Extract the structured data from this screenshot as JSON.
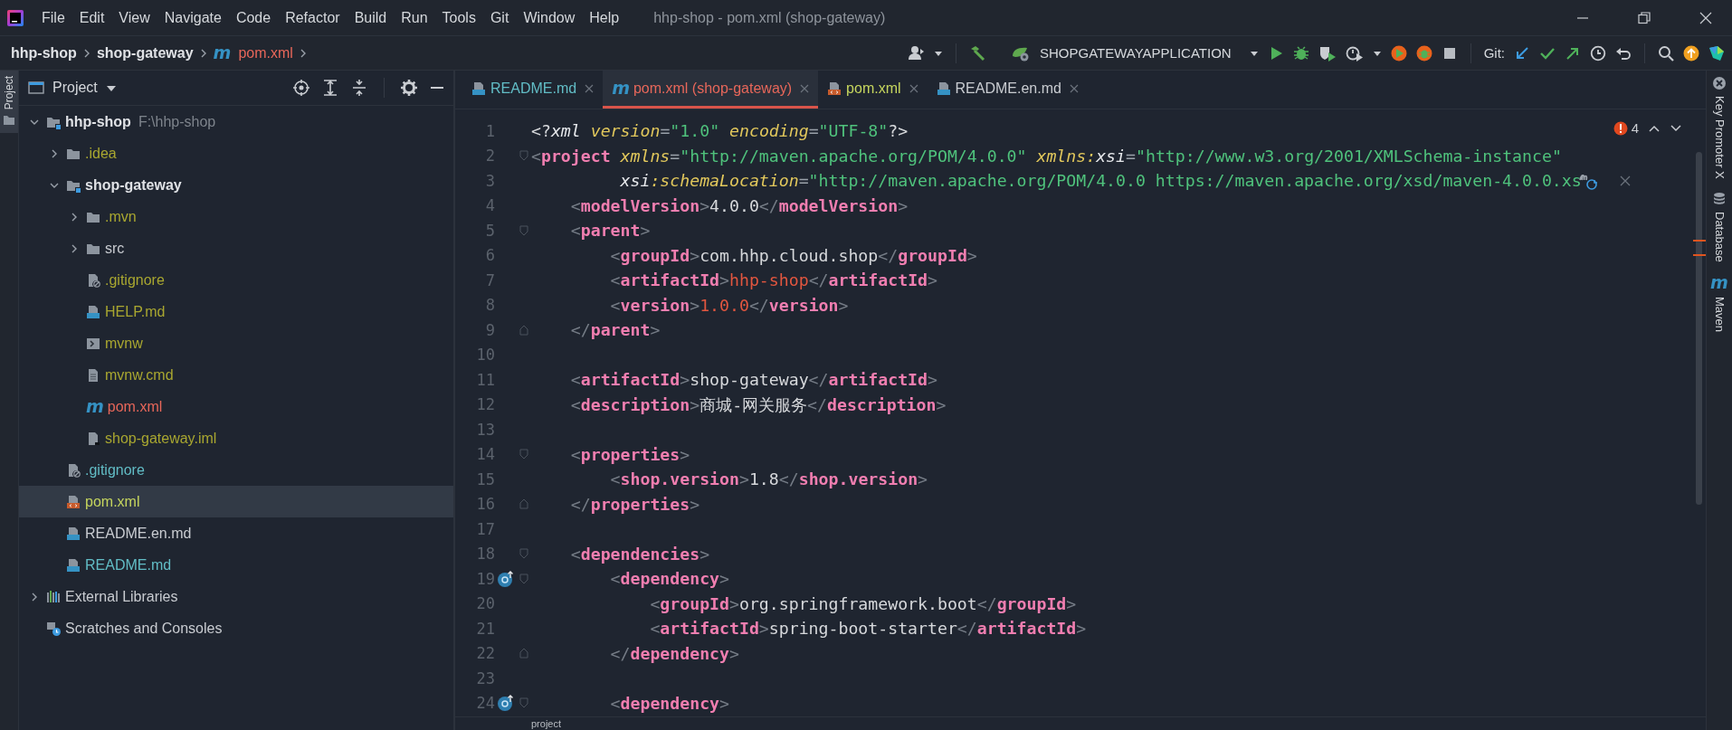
{
  "window": {
    "title": "hhp-shop - pom.xml (shop-gateway)"
  },
  "menu": [
    "File",
    "Edit",
    "View",
    "Navigate",
    "Code",
    "Refactor",
    "Build",
    "Run",
    "Tools",
    "Git",
    "Window",
    "Help"
  ],
  "breadcrumbs": [
    {
      "label": "hhp-shop",
      "kind": "module",
      "color": "#dfe1e5"
    },
    {
      "label": "shop-gateway",
      "kind": "module",
      "color": "#dfe1e5"
    },
    {
      "label": "pom.xml",
      "kind": "maven",
      "icon_text": "m",
      "color": "#e8675a"
    }
  ],
  "toolbar": {
    "run_config": "SHOPGATEWAYAPPLICATION",
    "git_label": "Git:"
  },
  "left_stripe": [
    {
      "label": "Project",
      "selected": true
    }
  ],
  "project_panel": {
    "title": "Project",
    "tree": [
      {
        "label": "hhp-shop",
        "hint": "F:\\hhp-shop",
        "kind": "module",
        "color": "#dfe1e5",
        "selected": false,
        "expanded": true,
        "children": [
          {
            "label": ".idea",
            "kind": "folder",
            "color": "#a9a730",
            "selected": false,
            "expanded": false
          },
          {
            "label": "shop-gateway",
            "kind": "module",
            "color": "#dfe1e5",
            "selected": false,
            "expanded": true,
            "children": [
              {
                "label": ".mvn",
                "kind": "folder",
                "color": "#a9a730",
                "selected": false,
                "expanded": false
              },
              {
                "label": "src",
                "kind": "folder",
                "color": "#c9ccd1",
                "selected": false,
                "expanded": false
              },
              {
                "label": ".gitignore",
                "kind": "ignored",
                "color": "#a9a730",
                "selected": false
              },
              {
                "label": "HELP.md",
                "kind": "markdown",
                "color": "#a9a730",
                "selected": false
              },
              {
                "label": "mvnw",
                "kind": "shell",
                "color": "#a9a730",
                "selected": false
              },
              {
                "label": "mvnw.cmd",
                "kind": "text",
                "color": "#a9a730",
                "selected": false
              },
              {
                "label": "pom.xml",
                "kind": "maven",
                "icon_text": "m",
                "color": "#e8675a",
                "selected": false
              },
              {
                "label": "shop-gateway.iml",
                "kind": "iml",
                "color": "#a9a730",
                "selected": false
              }
            ]
          },
          {
            "label": ".gitignore",
            "kind": "ignored",
            "color": "#62bdc6",
            "selected": false
          },
          {
            "label": "pom.xml",
            "kind": "xml",
            "color": "#c6d65e",
            "selected": true
          },
          {
            "label": "README.en.md",
            "kind": "markdown",
            "color": "#c9ccd1",
            "selected": false
          },
          {
            "label": "README.md",
            "kind": "markdown",
            "color": "#62bdc6",
            "selected": false
          }
        ]
      },
      {
        "label": "External Libraries",
        "kind": "libraries",
        "color": "#c9ccd1",
        "selected": false,
        "expanded": false
      },
      {
        "label": "Scratches and Consoles",
        "kind": "scratches",
        "color": "#c9ccd1",
        "selected": false
      }
    ]
  },
  "tabs": [
    {
      "label": "README.md",
      "kind": "markdown",
      "color": "#62bdc6",
      "selected": false
    },
    {
      "label": "pom.xml (shop-gateway)",
      "kind": "maven",
      "icon_text": "m",
      "color": "#e8675a",
      "selected": true
    },
    {
      "label": "pom.xml",
      "kind": "xml",
      "color": "#c6d65e",
      "selected": false
    },
    {
      "label": "README.en.md",
      "kind": "markdown",
      "color": "#c9ccd1",
      "selected": false
    }
  ],
  "problems": {
    "count": "4"
  },
  "code_lines": [
    {
      "number": "1",
      "kind": "plain",
      "tokens": [
        {
          "kind": "text",
          "text": "<?"
        },
        {
          "kind": "ns",
          "text": "xml"
        },
        {
          "kind": "attr",
          "text": " version"
        },
        {
          "kind": "punct",
          "text": "="
        },
        {
          "kind": "string",
          "text": "\"1.0\""
        },
        {
          "kind": "attr",
          "text": " encoding"
        },
        {
          "kind": "punct",
          "text": "="
        },
        {
          "kind": "string",
          "text": "\"UTF-8\""
        },
        {
          "kind": "text",
          "text": "?>"
        }
      ]
    },
    {
      "number": "2",
      "kind": "fold_start",
      "tokens": [
        {
          "kind": "bracket",
          "text": "<"
        },
        {
          "kind": "tag",
          "text": "project"
        },
        {
          "kind": "attr",
          "text": " xmlns"
        },
        {
          "kind": "punct",
          "text": "="
        },
        {
          "kind": "string",
          "text": "\"http://maven.apache.org/POM/4.0.0\""
        },
        {
          "kind": "attr",
          "text": " xmlns:"
        },
        {
          "kind": "ns",
          "text": "xsi"
        },
        {
          "kind": "punct",
          "text": "="
        },
        {
          "kind": "string",
          "text": "\"http://www.w3.org/2001/XMLSchema-instance\""
        }
      ]
    },
    {
      "number": "3",
      "kind": "with_inlay",
      "tokens": [
        {
          "kind": "ns",
          "text": "         xsi"
        },
        {
          "kind": "attr",
          "text": ":schemaLocation"
        },
        {
          "kind": "punct",
          "text": "="
        },
        {
          "kind": "string",
          "text": "\"http://maven.apache.org/POM/4.0.0 https://maven.apache.org/xsd/maven-4.0.0.xs"
        }
      ]
    },
    {
      "number": "4",
      "kind": "plain",
      "tokens": [
        {
          "kind": "bracket",
          "text": "    <"
        },
        {
          "kind": "tag",
          "text": "modelVersion"
        },
        {
          "kind": "bracket",
          "text": ">"
        },
        {
          "kind": "text",
          "text": "4.0.0"
        },
        {
          "kind": "bracket",
          "text": "</"
        },
        {
          "kind": "tag",
          "text": "modelVersion"
        },
        {
          "kind": "bracket",
          "text": ">"
        }
      ]
    },
    {
      "number": "5",
      "kind": "fold_start",
      "tokens": [
        {
          "kind": "bracket",
          "text": "    <"
        },
        {
          "kind": "tag",
          "text": "parent"
        },
        {
          "kind": "bracket",
          "text": ">"
        }
      ]
    },
    {
      "number": "6",
      "kind": "plain",
      "tokens": [
        {
          "kind": "bracket",
          "text": "        <"
        },
        {
          "kind": "tag",
          "text": "groupId"
        },
        {
          "kind": "bracket",
          "text": ">"
        },
        {
          "kind": "text",
          "text": "com.hhp.cloud.shop"
        },
        {
          "kind": "bracket",
          "text": "</"
        },
        {
          "kind": "tag",
          "text": "groupId"
        },
        {
          "kind": "bracket",
          "text": ">"
        }
      ]
    },
    {
      "number": "7",
      "kind": "plain",
      "tokens": [
        {
          "kind": "bracket",
          "text": "        <"
        },
        {
          "kind": "tag",
          "text": "artifactId"
        },
        {
          "kind": "bracket",
          "text": ">"
        },
        {
          "kind": "error",
          "text": "hhp-shop"
        },
        {
          "kind": "bracket",
          "text": "</"
        },
        {
          "kind": "tag",
          "text": "artifactId"
        },
        {
          "kind": "bracket",
          "text": ">"
        }
      ]
    },
    {
      "number": "8",
      "kind": "plain",
      "tokens": [
        {
          "kind": "bracket",
          "text": "        <"
        },
        {
          "kind": "tag",
          "text": "version"
        },
        {
          "kind": "bracket",
          "text": ">"
        },
        {
          "kind": "error",
          "text": "1.0.0"
        },
        {
          "kind": "bracket",
          "text": "</"
        },
        {
          "kind": "tag",
          "text": "version"
        },
        {
          "kind": "bracket",
          "text": ">"
        }
      ]
    },
    {
      "number": "9",
      "kind": "fold_end",
      "tokens": [
        {
          "kind": "bracket",
          "text": "    </"
        },
        {
          "kind": "tag",
          "text": "parent"
        },
        {
          "kind": "bracket",
          "text": ">"
        }
      ]
    },
    {
      "number": "10",
      "kind": "plain"
    },
    {
      "number": "11",
      "kind": "plain",
      "tokens": [
        {
          "kind": "bracket",
          "text": "    <"
        },
        {
          "kind": "tag",
          "text": "artifactId"
        },
        {
          "kind": "bracket",
          "text": ">"
        },
        {
          "kind": "text",
          "text": "shop-gateway"
        },
        {
          "kind": "bracket",
          "text": "</"
        },
        {
          "kind": "tag",
          "text": "artifactId"
        },
        {
          "kind": "bracket",
          "text": ">"
        }
      ]
    },
    {
      "number": "12",
      "kind": "plain",
      "tokens": [
        {
          "kind": "bracket",
          "text": "    <"
        },
        {
          "kind": "tag",
          "text": "description"
        },
        {
          "kind": "bracket",
          "text": ">"
        },
        {
          "kind": "text",
          "text": "商城-网关服务"
        },
        {
          "kind": "bracket",
          "text": "</"
        },
        {
          "kind": "tag",
          "text": "description"
        },
        {
          "kind": "bracket",
          "text": ">"
        }
      ]
    },
    {
      "number": "13",
      "kind": "plain"
    },
    {
      "number": "14",
      "kind": "fold_start",
      "tokens": [
        {
          "kind": "bracket",
          "text": "    <"
        },
        {
          "kind": "tag",
          "text": "properties"
        },
        {
          "kind": "bracket",
          "text": ">"
        }
      ]
    },
    {
      "number": "15",
      "kind": "plain",
      "tokens": [
        {
          "kind": "bracket",
          "text": "        <"
        },
        {
          "kind": "tag",
          "text": "shop.version"
        },
        {
          "kind": "bracket",
          "text": ">"
        },
        {
          "kind": "text",
          "text": "1.8"
        },
        {
          "kind": "bracket",
          "text": "</"
        },
        {
          "kind": "tag",
          "text": "shop.version"
        },
        {
          "kind": "bracket",
          "text": ">"
        }
      ]
    },
    {
      "number": "16",
      "kind": "fold_end",
      "tokens": [
        {
          "kind": "bracket",
          "text": "    </"
        },
        {
          "kind": "tag",
          "text": "properties"
        },
        {
          "kind": "bracket",
          "text": ">"
        }
      ]
    },
    {
      "number": "17",
      "kind": "plain"
    },
    {
      "number": "18",
      "kind": "fold_start",
      "tokens": [
        {
          "kind": "bracket",
          "text": "    <"
        },
        {
          "kind": "tag",
          "text": "dependencies"
        },
        {
          "kind": "bracket",
          "text": ">"
        }
      ]
    },
    {
      "number": "19",
      "kind": "marked_fold_start",
      "tokens": [
        {
          "kind": "bracket",
          "text": "        <"
        },
        {
          "kind": "tag",
          "text": "dependency"
        },
        {
          "kind": "bracket",
          "text": ">"
        }
      ]
    },
    {
      "number": "20",
      "kind": "plain",
      "tokens": [
        {
          "kind": "bracket",
          "text": "            <"
        },
        {
          "kind": "tag",
          "text": "groupId"
        },
        {
          "kind": "bracket",
          "text": ">"
        },
        {
          "kind": "text",
          "text": "org.springframework.boot"
        },
        {
          "kind": "bracket",
          "text": "</"
        },
        {
          "kind": "tag",
          "text": "groupId"
        },
        {
          "kind": "bracket",
          "text": ">"
        }
      ]
    },
    {
      "number": "21",
      "kind": "plain",
      "tokens": [
        {
          "kind": "bracket",
          "text": "            <"
        },
        {
          "kind": "tag",
          "text": "artifactId"
        },
        {
          "kind": "bracket",
          "text": ">"
        },
        {
          "kind": "text",
          "text": "spring-boot-starter"
        },
        {
          "kind": "bracket",
          "text": "</"
        },
        {
          "kind": "tag",
          "text": "artifactId"
        },
        {
          "kind": "bracket",
          "text": ">"
        }
      ]
    },
    {
      "number": "22",
      "kind": "fold_end",
      "tokens": [
        {
          "kind": "bracket",
          "text": "        </"
        },
        {
          "kind": "tag",
          "text": "dependency"
        },
        {
          "kind": "bracket",
          "text": ">"
        }
      ]
    },
    {
      "number": "23",
      "kind": "plain"
    },
    {
      "number": "24",
      "kind": "marked_fold_start",
      "tokens": [
        {
          "kind": "bracket",
          "text": "        <"
        },
        {
          "kind": "tag",
          "text": "dependency"
        },
        {
          "kind": "bracket",
          "text": ">"
        }
      ]
    }
  ],
  "editor_breadcrumb": "project",
  "right_stripe": [
    {
      "label": "Key Promoter X",
      "kind": "keypromoter"
    },
    {
      "label": "Database",
      "kind": "database"
    },
    {
      "label": "Maven",
      "kind": "maven",
      "icon_text": "m"
    }
  ]
}
